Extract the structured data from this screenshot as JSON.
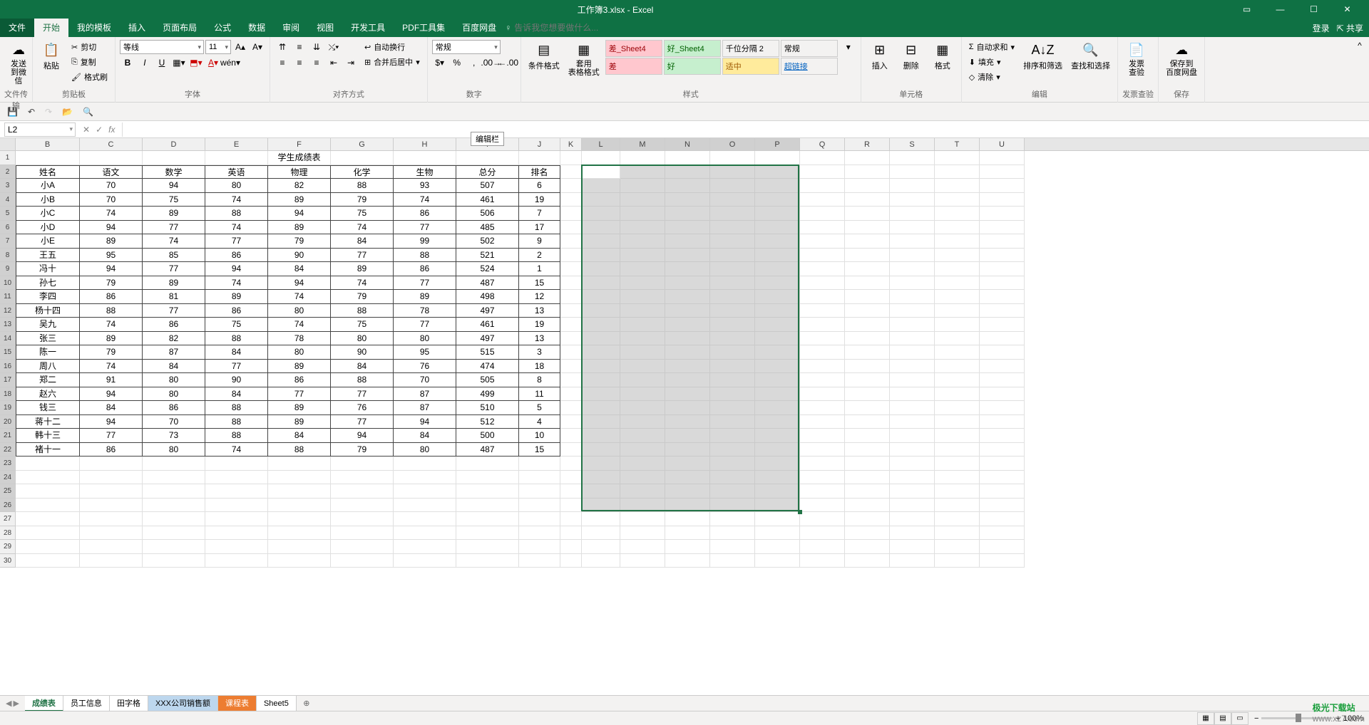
{
  "window": {
    "title": "工作簿3.xlsx - Excel",
    "login": "登录",
    "share": "共享"
  },
  "menu": {
    "file": "文件",
    "home": "开始",
    "template": "我的模板",
    "insert": "插入",
    "layout": "页面布局",
    "formula": "公式",
    "data": "数据",
    "review": "审阅",
    "view": "视图",
    "dev": "开发工具",
    "pdf": "PDF工具集",
    "baidu": "百度网盘",
    "tell": "告诉我您想要做什么..."
  },
  "ribbon": {
    "wechat": "发送\n到微信",
    "paste": "粘贴",
    "cut": "剪切",
    "copy": "复制",
    "format": "格式刷",
    "clipboard": "剪贴板",
    "filetrans": "文件传输",
    "font": "等线",
    "size": "11",
    "fontgrp": "字体",
    "wrap": "自动换行",
    "merge": "合并后居中",
    "align": "对齐方式",
    "numfmt": "常规",
    "number": "数字",
    "condfmt": "条件格式",
    "tablefmt": "套用\n表格格式",
    "s_bad_sheet": "差_Sheet4",
    "s_good_sheet": "好_Sheet4",
    "s_thousand": "千位分隔 2",
    "s_normal": "常规",
    "s_bad": "差",
    "s_good": "好",
    "s_mid": "适中",
    "s_link": "超链接",
    "styles": "样式",
    "ins": "插入",
    "del": "删除",
    "fmt": "格式",
    "cells": "单元格",
    "sum": "自动求和",
    "fill": "填充",
    "clear": "清除",
    "sortfilt": "排序和筛选",
    "findselect": "查找和选择",
    "edit": "编辑",
    "invoice": "发票\n查验",
    "invgrp": "发票查验",
    "savebaidu": "保存到\n百度网盘",
    "savegrp": "保存"
  },
  "tooltip": "编辑栏",
  "namebox": "L2",
  "colwidths": {
    "B": 90,
    "C": 88,
    "D": 88,
    "E": 88,
    "F": 88,
    "G": 88,
    "H": 88,
    "I": 88,
    "J": 58,
    "K": 30,
    "L": 54,
    "M": 63,
    "N": 63,
    "O": 63,
    "P": 63,
    "Q": 63,
    "R": 63,
    "S": 63,
    "T": 63,
    "U": 63
  },
  "columns": [
    "B",
    "C",
    "D",
    "E",
    "F",
    "G",
    "H",
    "I",
    "J",
    "K",
    "L",
    "M",
    "N",
    "O",
    "P",
    "Q",
    "R",
    "S",
    "T",
    "U"
  ],
  "table": {
    "title": "学生成绩表",
    "headers": [
      "姓名",
      "语文",
      "数学",
      "英语",
      "物理",
      "化学",
      "生物",
      "总分",
      "排名"
    ],
    "rows": [
      [
        "小A",
        "70",
        "94",
        "80",
        "82",
        "88",
        "93",
        "507",
        "6"
      ],
      [
        "小B",
        "70",
        "75",
        "74",
        "89",
        "79",
        "74",
        "461",
        "19"
      ],
      [
        "小C",
        "74",
        "89",
        "88",
        "94",
        "75",
        "86",
        "506",
        "7"
      ],
      [
        "小D",
        "94",
        "77",
        "74",
        "89",
        "74",
        "77",
        "485",
        "17"
      ],
      [
        "小E",
        "89",
        "74",
        "77",
        "79",
        "84",
        "99",
        "502",
        "9"
      ],
      [
        "王五",
        "95",
        "85",
        "86",
        "90",
        "77",
        "88",
        "521",
        "2"
      ],
      [
        "冯十",
        "94",
        "77",
        "94",
        "84",
        "89",
        "86",
        "524",
        "1"
      ],
      [
        "孙七",
        "79",
        "89",
        "74",
        "94",
        "74",
        "77",
        "487",
        "15"
      ],
      [
        "李四",
        "86",
        "81",
        "89",
        "74",
        "79",
        "89",
        "498",
        "12"
      ],
      [
        "杨十四",
        "88",
        "77",
        "86",
        "80",
        "88",
        "78",
        "497",
        "13"
      ],
      [
        "吴九",
        "74",
        "86",
        "75",
        "74",
        "75",
        "77",
        "461",
        "19"
      ],
      [
        "张三",
        "89",
        "82",
        "88",
        "78",
        "80",
        "80",
        "497",
        "13"
      ],
      [
        "陈一",
        "79",
        "87",
        "84",
        "80",
        "90",
        "95",
        "515",
        "3"
      ],
      [
        "周八",
        "74",
        "84",
        "77",
        "89",
        "84",
        "76",
        "474",
        "18"
      ],
      [
        "郑二",
        "91",
        "80",
        "90",
        "86",
        "88",
        "70",
        "505",
        "8"
      ],
      [
        "赵六",
        "94",
        "80",
        "84",
        "77",
        "77",
        "87",
        "499",
        "11"
      ],
      [
        "钱三",
        "84",
        "86",
        "88",
        "89",
        "76",
        "87",
        "510",
        "5"
      ],
      [
        "蒋十二",
        "94",
        "70",
        "88",
        "89",
        "77",
        "94",
        "512",
        "4"
      ],
      [
        "韩十三",
        "77",
        "73",
        "88",
        "84",
        "94",
        "84",
        "500",
        "10"
      ],
      [
        "褚十一",
        "86",
        "80",
        "74",
        "88",
        "79",
        "80",
        "487",
        "15"
      ]
    ]
  },
  "sheets": {
    "t1": "成绩表",
    "t2": "员工信息",
    "t3": "田字格",
    "t4": "XXX公司销售额",
    "t5": "课程表",
    "t6": "Sheet5"
  },
  "status": {
    "zoom": "100%"
  },
  "watermark": {
    "brand": "极光下载站",
    "url": "www.xz7.com"
  }
}
